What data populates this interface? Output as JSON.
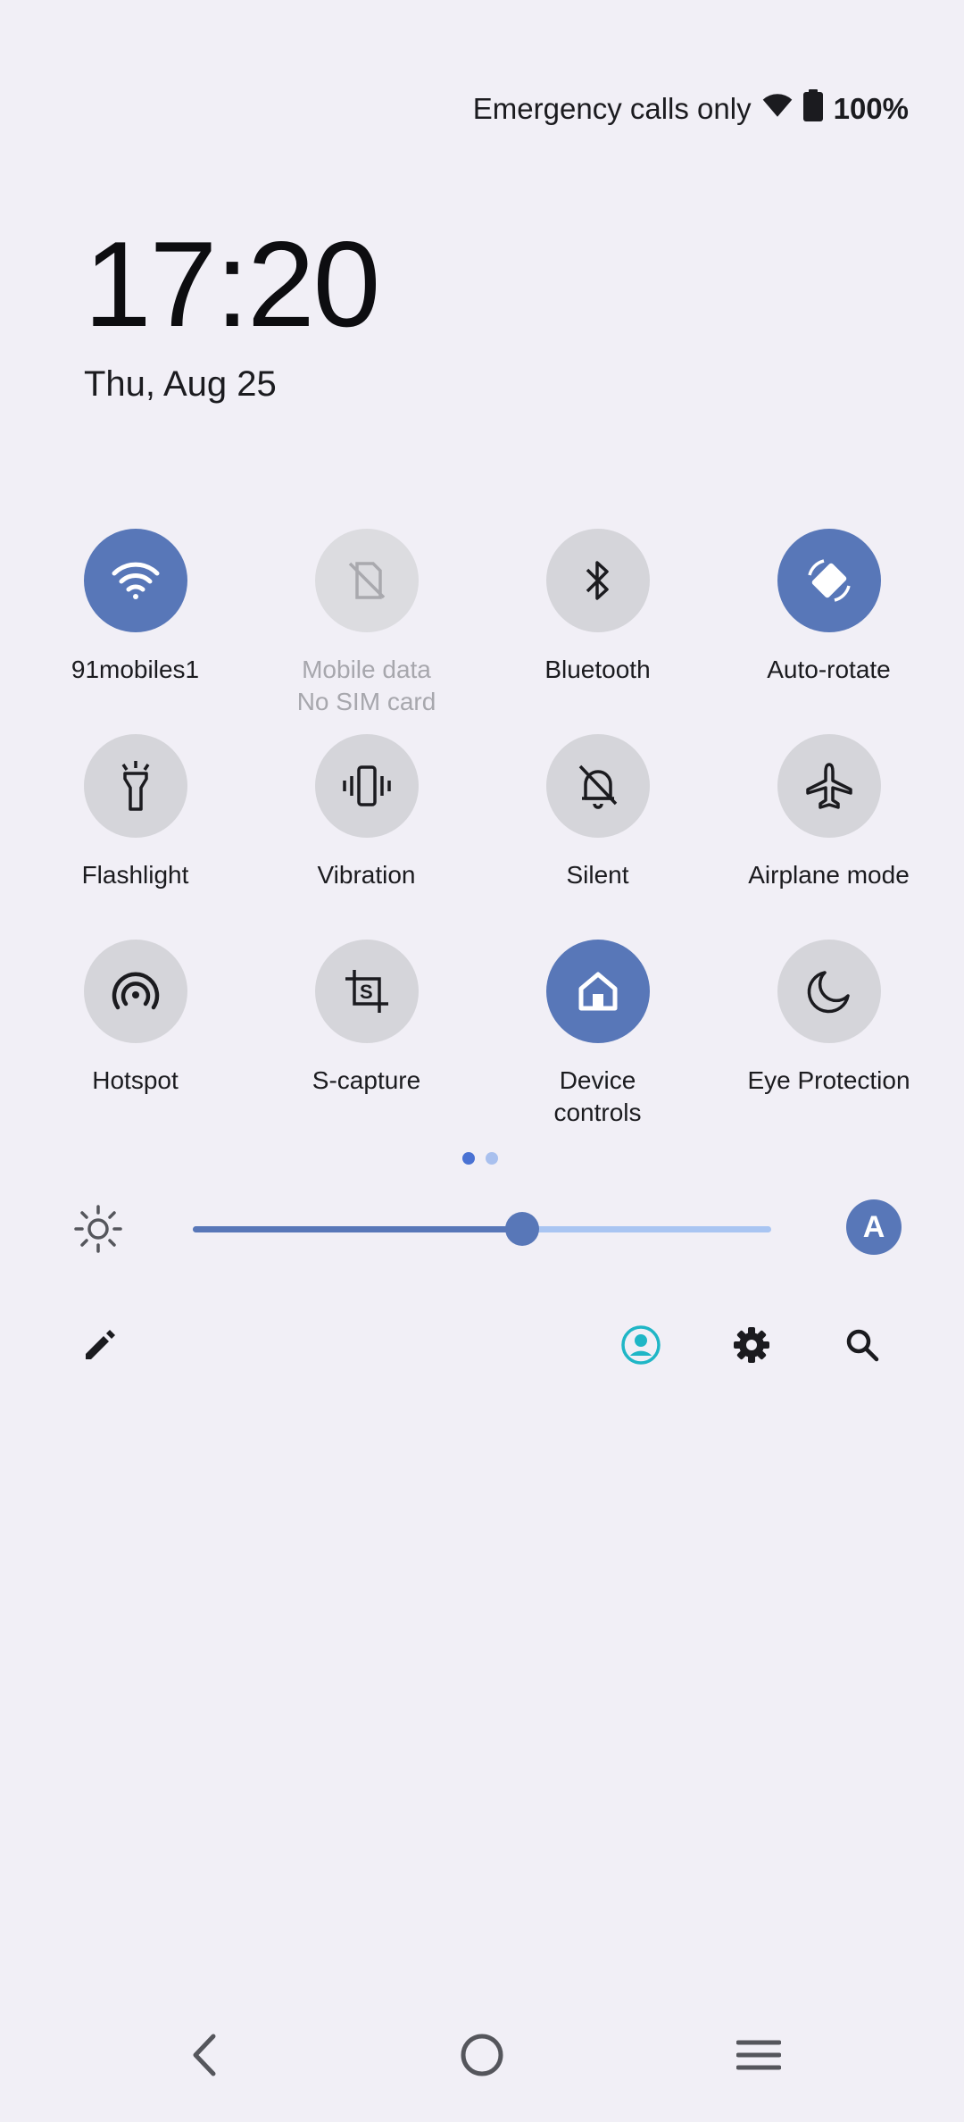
{
  "status_bar": {
    "carrier": "Emergency calls only",
    "battery": "100%"
  },
  "clock": {
    "time": "17:20",
    "date": "Thu, Aug 25"
  },
  "tiles": [
    {
      "label": "91mobiles1",
      "state": "active",
      "icon": "wifi-icon"
    },
    {
      "label": "Mobile data",
      "sublabel": "No SIM card",
      "state": "disabled",
      "icon": "no-sim-icon"
    },
    {
      "label": "Bluetooth",
      "state": "inactive",
      "icon": "bluetooth-icon"
    },
    {
      "label": "Auto-rotate",
      "state": "active",
      "icon": "auto-rotate-icon"
    },
    {
      "label": "Flashlight",
      "state": "inactive",
      "icon": "flashlight-icon"
    },
    {
      "label": "Vibration",
      "state": "inactive",
      "icon": "vibration-icon"
    },
    {
      "label": "Silent",
      "state": "inactive",
      "icon": "silent-icon"
    },
    {
      "label": "Airplane mode",
      "state": "inactive",
      "icon": "airplane-icon"
    },
    {
      "label": "Hotspot",
      "state": "inactive",
      "icon": "hotspot-icon"
    },
    {
      "label": "S-capture",
      "state": "inactive",
      "icon": "s-capture-icon"
    },
    {
      "label": "Device",
      "sublabel": "controls",
      "state": "active",
      "icon": "home-icon"
    },
    {
      "label": "Eye Protection",
      "state": "inactive",
      "icon": "moon-icon"
    }
  ],
  "pager": {
    "current": 1,
    "total": 2
  },
  "brightness": {
    "level": 0.57,
    "auto_label": "A"
  },
  "colors": {
    "accent": "#5877b8",
    "background": "#f1eff6",
    "inactive_tile": "#d5d5da",
    "user_icon": "#1fb6c6"
  }
}
